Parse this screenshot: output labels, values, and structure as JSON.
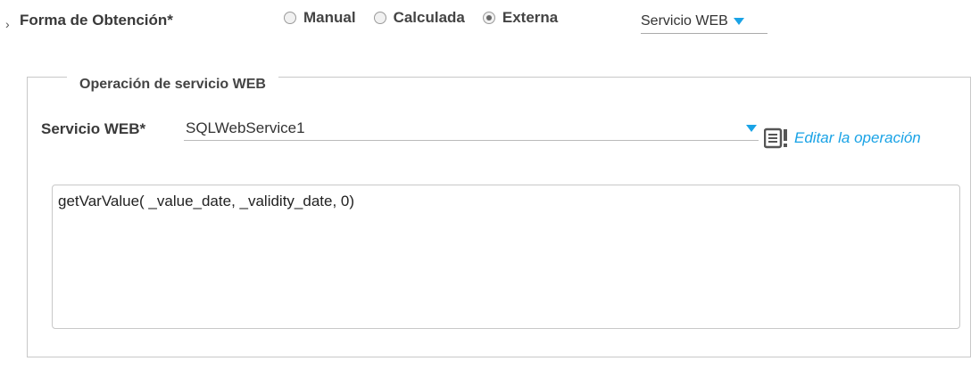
{
  "form": {
    "obtention_label": "Forma de Obtención*",
    "options": [
      {
        "label": "Manual",
        "checked": false
      },
      {
        "label": "Calculada",
        "checked": false
      },
      {
        "label": "Externa",
        "checked": true
      }
    ],
    "source_select": "Servicio WEB"
  },
  "section": {
    "legend": "Operación de servicio WEB",
    "ws_label": "Servicio WEB*",
    "ws_value": "SQLWebService1",
    "edit_link": "Editar la operación",
    "code": "getVarValue( _value_date, _validity_date, 0)"
  },
  "colors": {
    "accent": "#1aa3e6",
    "border": "#c8c8c8"
  },
  "icons": {
    "chevron": "chevron-right-icon",
    "edit": "edit-operation-icon"
  }
}
